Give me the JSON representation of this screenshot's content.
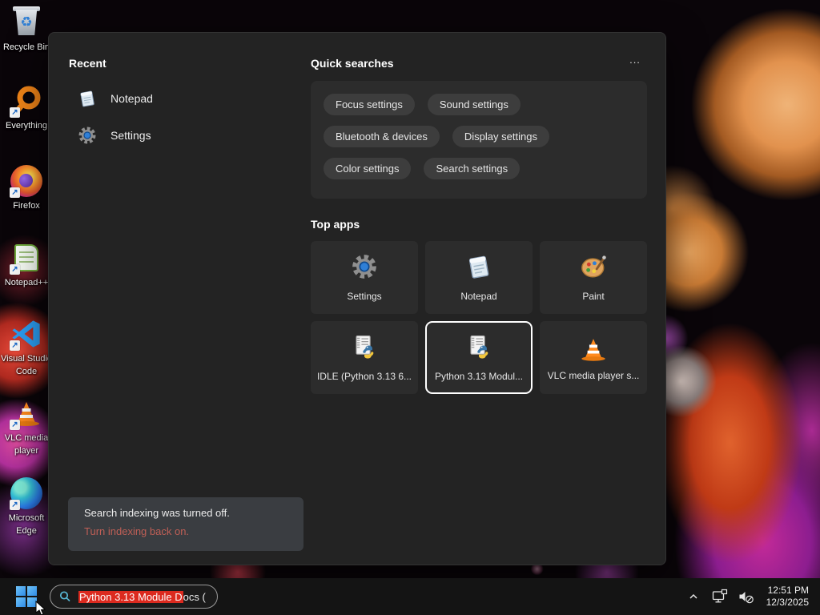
{
  "desktop": {
    "icons": [
      {
        "id": "recycle-bin",
        "lines": [
          "Recycle Bin"
        ]
      },
      {
        "id": "everything",
        "lines": [
          "Everything"
        ]
      },
      {
        "id": "firefox",
        "lines": [
          "Firefox"
        ]
      },
      {
        "id": "notepad-plus-plus",
        "lines": [
          "Notepad++"
        ]
      },
      {
        "id": "visual-studio-code",
        "lines": [
          "Visual Studio",
          "Code"
        ]
      },
      {
        "id": "vlc-media-player",
        "lines": [
          "VLC media",
          "player"
        ]
      },
      {
        "id": "microsoft-edge",
        "lines": [
          "Microsoft",
          "Edge"
        ]
      }
    ]
  },
  "search_panel": {
    "recent": {
      "title": "Recent",
      "items": [
        {
          "label": "Notepad"
        },
        {
          "label": "Settings"
        }
      ]
    },
    "quick_searches": {
      "title": "Quick searches",
      "more_label": "...",
      "pills": [
        "Focus settings",
        "Sound settings",
        "Bluetooth & devices",
        "Display settings",
        "Color settings",
        "Search settings"
      ]
    },
    "top_apps": {
      "title": "Top apps",
      "tiles": [
        {
          "label": "Settings",
          "selected": false
        },
        {
          "label": "Notepad",
          "selected": false
        },
        {
          "label": "Paint",
          "selected": false
        },
        {
          "label": "IDLE (Python 3.13 6...",
          "selected": false
        },
        {
          "label": "Python 3.13 Modul...",
          "selected": true
        },
        {
          "label": "VLC media player s...",
          "selected": false
        }
      ]
    },
    "indexing_notice": {
      "line1": "Search indexing was turned off.",
      "line2": "Turn indexing back on."
    }
  },
  "taskbar": {
    "search": {
      "selected_text": "Python 3.13 Module D",
      "rest_text": "ocs ("
    },
    "tray": {
      "time": "12:51 PM",
      "date": "12/3/2025"
    }
  },
  "colors": {
    "accent_blue": "#2f8ce8",
    "selection_red": "#dc2a1f",
    "notice_link_red": "#bf5f56",
    "panel_bg": "#232323",
    "card_bg": "#2c2c2c",
    "pill_bg": "#3d3d3d",
    "taskbar_bg": "#141414"
  }
}
